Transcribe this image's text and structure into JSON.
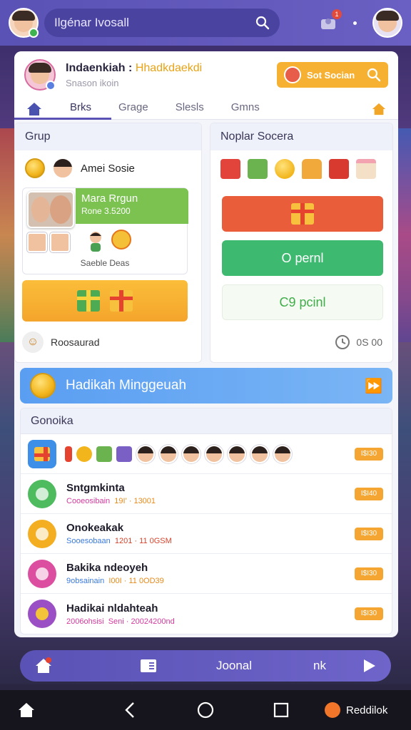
{
  "topbar": {
    "search_text": "Ilgénar Ivosall",
    "notification_count": "1"
  },
  "profile": {
    "title_main": "Indaenkiah :",
    "title_accent": "Hhadkdaekdi",
    "subtitle": "Snason ikoin",
    "set_button": "Sot Socian"
  },
  "tabs": [
    {
      "label": "Brks"
    },
    {
      "label": "Grage"
    },
    {
      "label": "Slesls"
    },
    {
      "label": "Gmns"
    }
  ],
  "grup": {
    "header": "Grup",
    "name": "Amei Sosie",
    "card_title": "Mara Rrgun",
    "card_sub": "Rone 3.5200",
    "caption": "Saeble Deas",
    "footer": "Roosaurad"
  },
  "popular": {
    "header": "Noplar Socera",
    "btn2": "O pernl",
    "btn3": "C9 pcinl",
    "footer": "0S 00"
  },
  "weekly_banner": {
    "label": "Hadikah Minggeuah"
  },
  "gift_list": {
    "header": "Gonoika",
    "top_price": "I$I30",
    "rows": [
      {
        "title": "Sntgmkinta",
        "sub1": "Cooeosibain",
        "sub2": "19I' · 13001",
        "price": "I$I40",
        "icon": "chat-bubble-icon",
        "color": "green"
      },
      {
        "title": "Onokeakak",
        "sub1": "Sooesobaan",
        "sub2": "1201 · 11 0GSM",
        "price": "I$I30",
        "icon": "bottle-icon",
        "color": "amber"
      },
      {
        "title": "Bakika ndeoyeh",
        "sub1": "9obsainain",
        "sub2": "I00I · 11 0OD39",
        "price": "I$I30",
        "icon": "dial-icon",
        "color": "pink"
      },
      {
        "title": "Hadikai nldahteah",
        "sub1": "2006ohsisi",
        "sub2": "Seni · 20024200nd",
        "price": "I$I30",
        "icon": "medal-icon",
        "color": "purple"
      }
    ]
  },
  "app_nav": {
    "journal": "Joonal",
    "extra": "nk"
  },
  "system_bar": {
    "app_label": "Reddilok"
  },
  "colors": {
    "primary": "#5a52b5",
    "accent_orange": "#f6b132",
    "banner_blue": "#5a9ef2",
    "green": "#7bc250"
  }
}
